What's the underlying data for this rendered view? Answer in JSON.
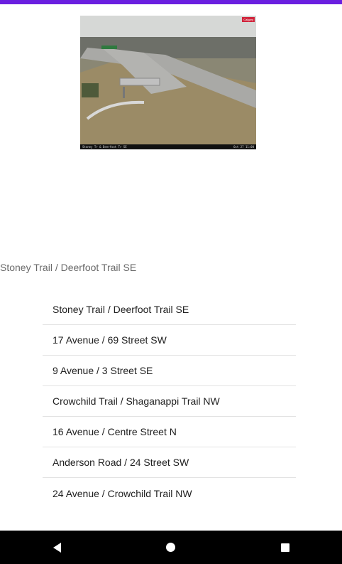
{
  "selected_camera": "Stoney Trail / Deerfoot Trail SE",
  "camera_image": {
    "logo_text": "Calgary",
    "caption_left": "Stoney Tr & Deerfoot Tr SE",
    "caption_right": "Oct 27 11:00"
  },
  "camera_list": [
    {
      "label": "Stoney Trail / Deerfoot Trail SE"
    },
    {
      "label": "17 Avenue / 69 Street SW"
    },
    {
      "label": "9 Avenue / 3 Street SE"
    },
    {
      "label": "Crowchild Trail / Shaganappi Trail NW"
    },
    {
      "label": "16 Avenue / Centre Street N"
    },
    {
      "label": "Anderson Road / 24 Street SW"
    },
    {
      "label": "24 Avenue / Crowchild Trail NW"
    }
  ],
  "nav": {
    "back_icon": "back-triangle-icon",
    "home_icon": "home-circle-icon",
    "recents_icon": "recents-square-icon"
  },
  "colors": {
    "status_bar": "#6a1fe0",
    "nav_bar": "#000000"
  }
}
